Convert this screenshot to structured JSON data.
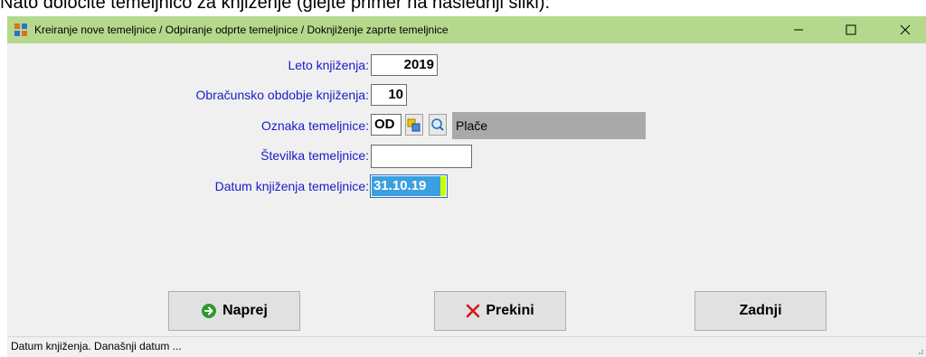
{
  "document": {
    "text_above": "Nato določite temeljnico za knjiženje (glejte primer na naslednji sliki):"
  },
  "window": {
    "title": "Kreiranje nove temeljnice / Odpiranje odprte temeljnice / Doknjiženje zaprte temeljnice",
    "controls": {
      "minimize": "—",
      "maximize": "☐",
      "close": "✕"
    }
  },
  "form": {
    "year_label": "Leto knjiženja:",
    "year_value": "2019",
    "period_label": "Obračunsko obdobje knjiženja:",
    "period_value": "10",
    "code_label": "Oznaka temeljnice:",
    "code_value": "OD",
    "code_description": "Plače",
    "number_label": "Številka temeljnice:",
    "number_value": "",
    "date_label": "Datum knjiženja temeljnice:",
    "date_value": "31.10.19"
  },
  "buttons": {
    "next": "Naprej",
    "cancel": "Prekini",
    "last": "Zadnji"
  },
  "status": {
    "text": "Datum knjiženja. Današnji datum ..."
  },
  "colors": {
    "titlebar": "#b5d98c",
    "label_text": "#1a1acc",
    "date_highlight": "#3aa0e0",
    "description_bg": "#a9a9a9"
  }
}
